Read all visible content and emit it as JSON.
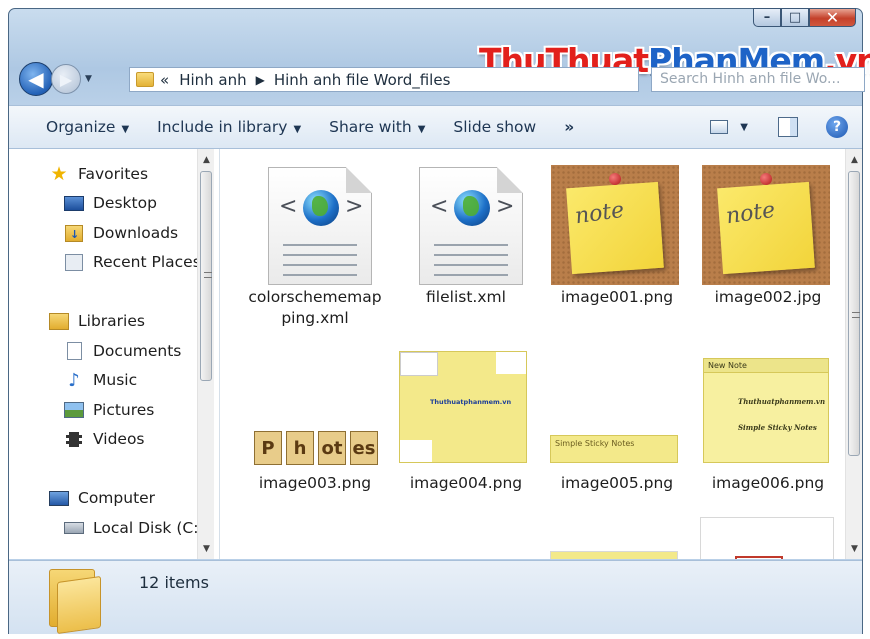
{
  "window": {
    "minimize_label": "–",
    "maximize_label": "□",
    "close_label": "✕"
  },
  "navigation": {
    "back_label": "◀",
    "forward_label": "▶",
    "dropdown_label": "▼",
    "breadcrumb_overflow": "«",
    "breadcrumb_sep": "▶",
    "breadcrumb": [
      "Hinh anh",
      "Hinh anh file Word_files"
    ],
    "refresh_label": "↻",
    "search_placeholder": "Search Hinh anh file Wo..."
  },
  "watermark": {
    "part1": "ThuThuat",
    "part2": "PhanMem",
    "part3": ".vn"
  },
  "toolbar": {
    "items": [
      "Organize",
      "Include in library",
      "Share with",
      "Slide show"
    ],
    "more_label": "»",
    "dropdown_arrow": "▼",
    "help_label": "?"
  },
  "nav_pane": {
    "favorites_label": "Favorites",
    "favorites": [
      "Desktop",
      "Downloads",
      "Recent Places"
    ],
    "libraries_label": "Libraries",
    "libraries": [
      "Documents",
      "Music",
      "Pictures",
      "Videos"
    ],
    "computer_label": "Computer",
    "computer": [
      "Local Disk (C:)"
    ]
  },
  "files": [
    {
      "name": "colorschememapping.xml",
      "line1": "colorschememap",
      "line2": "ping.xml",
      "type": "xml-icon"
    },
    {
      "name": "filelist.xml",
      "line1": "filelist.xml",
      "line2": "",
      "type": "xml-icon"
    },
    {
      "name": "image001.png",
      "line1": "image001.png",
      "line2": "",
      "type": "note-thumbnail"
    },
    {
      "name": "image002.jpg",
      "line1": "image002.jpg",
      "line2": "",
      "type": "note-thumbnail"
    },
    {
      "name": "image003.png",
      "line1": "image003.png",
      "line2": "",
      "type": "photos-thumbnail"
    },
    {
      "name": "image004.png",
      "line1": "image004.png",
      "line2": "",
      "type": "screenshot-thumbnail"
    },
    {
      "name": "image005.png",
      "line1": "image005.png",
      "line2": "",
      "type": "sticky-notes-thumbnail"
    },
    {
      "name": "image006.png",
      "line1": "image006.png",
      "line2": "",
      "type": "screenshot-thumbnail"
    }
  ],
  "thumbnails": {
    "note_text": "note",
    "photos_letters": [
      "P",
      "h",
      "ot",
      "es"
    ],
    "image004_text": "Thuthuatphanmem.vn",
    "image005_title": "Simple Sticky Notes",
    "image006_title": "New Note",
    "image006_line1": "Thuthuatphanmem.vn",
    "image006_line2": "Simple Sticky Notes"
  },
  "status": {
    "items_count": "12 items"
  }
}
